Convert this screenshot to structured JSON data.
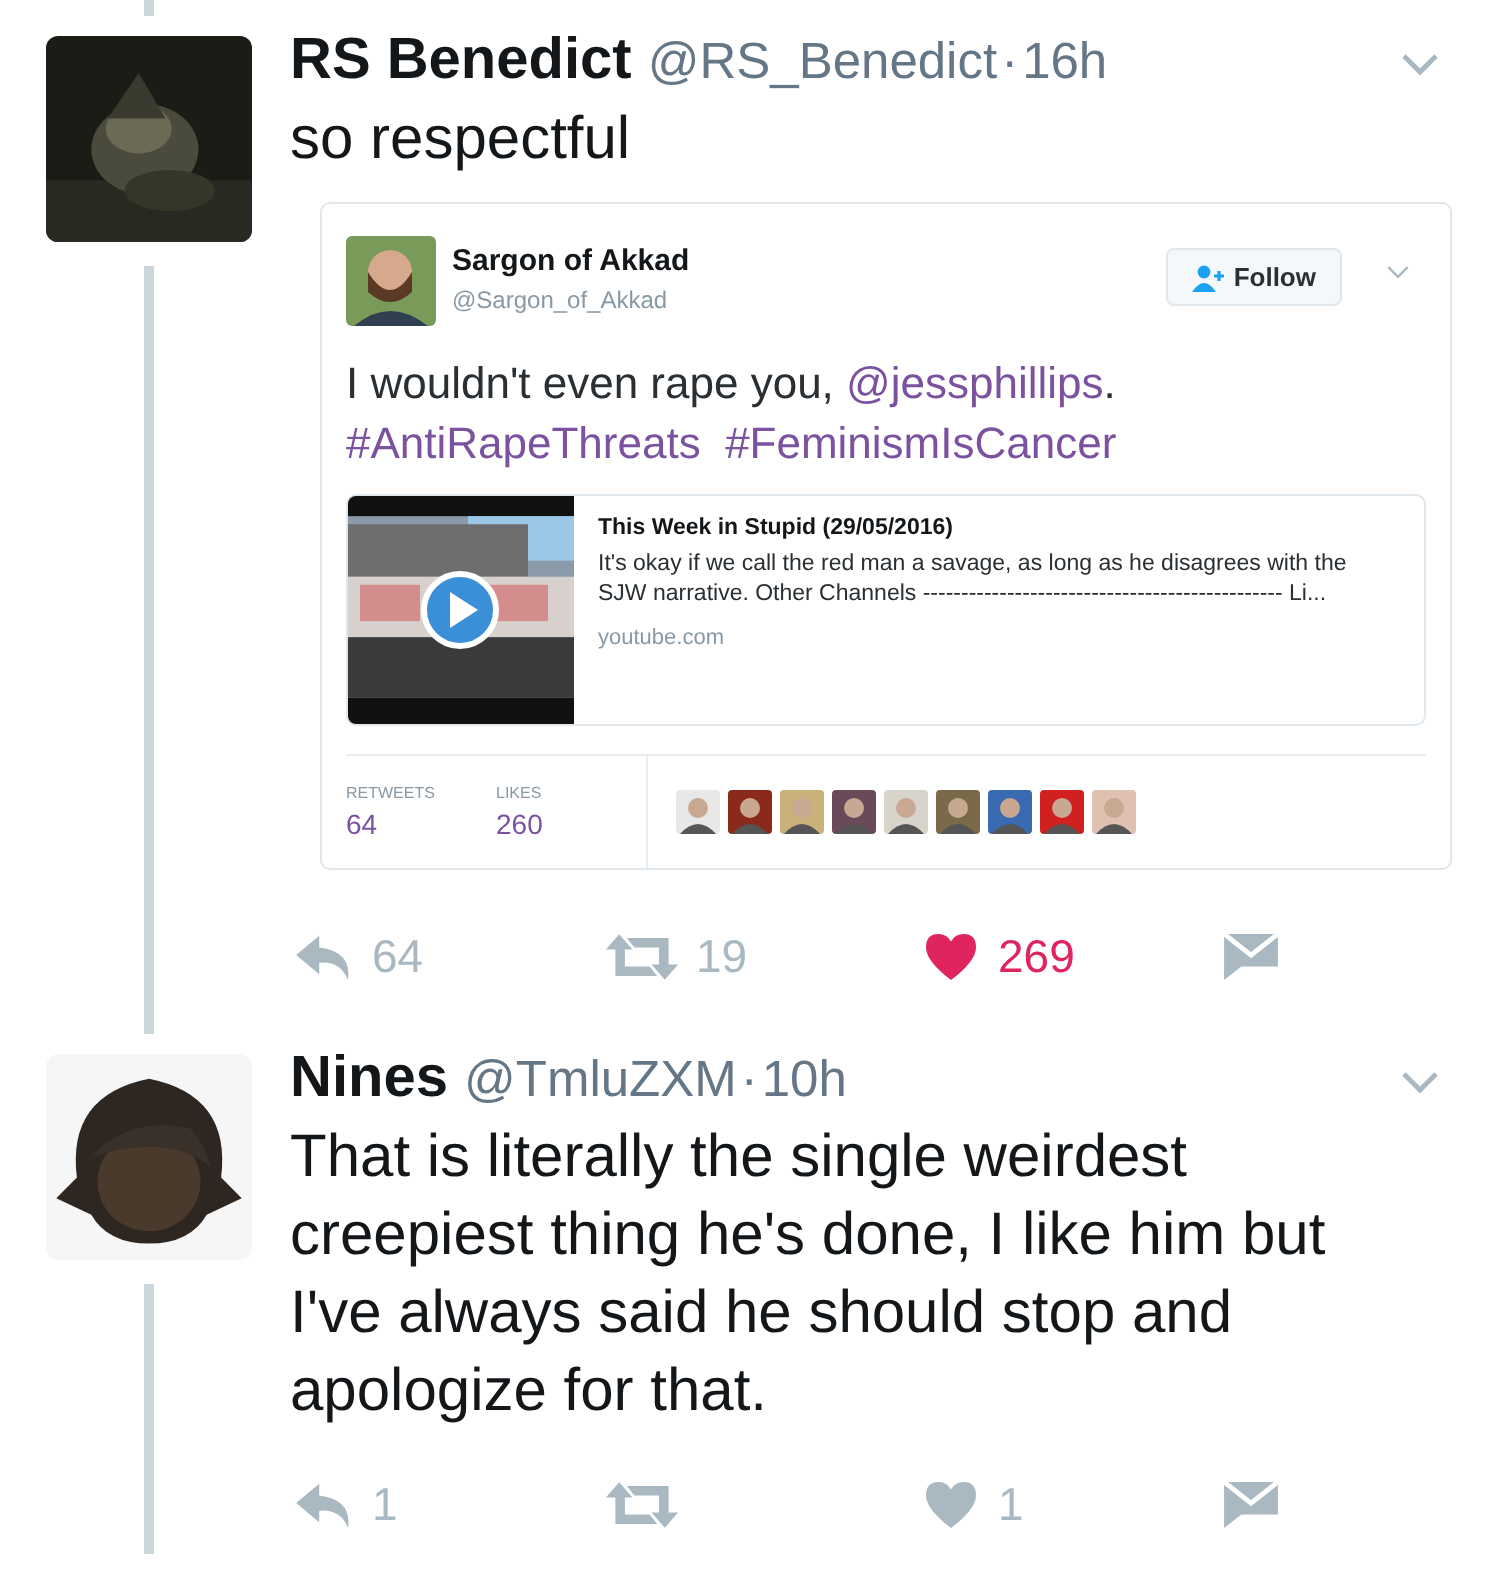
{
  "tweets": [
    {
      "name": "RS Benedict",
      "handle": "@RS_Benedict",
      "separator": "·",
      "time": "16h",
      "avatar": {
        "kind": "picture"
      },
      "text": "so respectful",
      "quote": {
        "name": "Sargon of Akkad",
        "handle": "@Sargon_of_Akkad",
        "follow": "Follow",
        "text": [
          {
            "kind": "plain",
            "text": "I wouldn't even rape you, "
          },
          {
            "kind": "link",
            "text": "@jessphillips"
          },
          {
            "kind": "plain",
            "text": ". "
          },
          {
            "kind": "link",
            "text": "#AntiRapeThreats"
          },
          {
            "kind": "link",
            "text": "#FeminismIsCancer"
          }
        ],
        "card": {
          "title": "This Week in Stupid (29/05/2016)",
          "description": "It's okay if we call the red man a savage, as long as he disagrees with the SJW narrative. Other Channels ----------------------------------------------- Li...",
          "domain": "youtube.com"
        },
        "stats": [
          {
            "label": "RETWEETS",
            "value": "64"
          },
          {
            "label": "LIKES",
            "value": "260"
          }
        ],
        "likers": [
          {
            "kind": "picture"
          },
          {
            "kind": "picture"
          },
          {
            "kind": "picture"
          },
          {
            "kind": "picture"
          },
          {
            "kind": "picture"
          },
          {
            "kind": "picture"
          },
          {
            "kind": "picture"
          },
          {
            "kind": "picture"
          },
          {
            "kind": "picture"
          }
        ]
      },
      "actions": [
        {
          "kind": "reply",
          "count": "64"
        },
        {
          "kind": "retweet",
          "count": "19",
          "selected": false
        },
        {
          "kind": "like",
          "count": "269",
          "selected": true
        },
        {
          "kind": "message"
        }
      ]
    },
    {
      "name": "Nines",
      "handle": "@TmluZXM",
      "separator": "·",
      "time": "10h",
      "avatar": {
        "kind": "cartoon"
      },
      "text": "That is literally the single weirdest creepiest thing he's done, I like him but I've always said he should stop and apologize for that.",
      "actions": [
        {
          "kind": "reply",
          "count": "1"
        },
        {
          "kind": "retweet",
          "selected": false
        },
        {
          "kind": "like",
          "count": "1",
          "selected": false
        },
        {
          "kind": "message"
        }
      ]
    }
  ]
}
